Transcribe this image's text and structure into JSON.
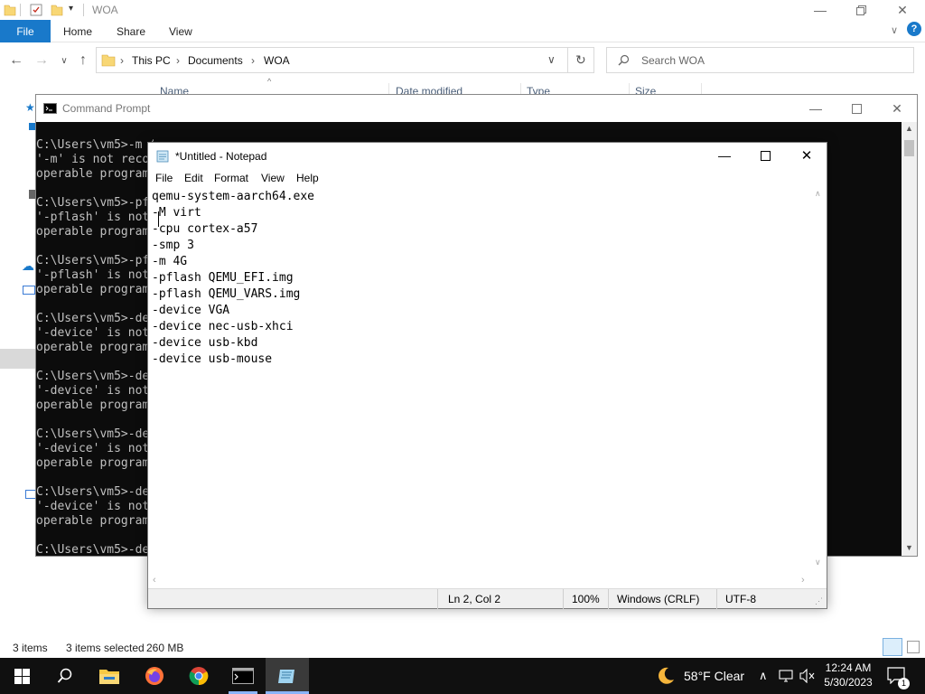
{
  "explorer": {
    "title": "WOA",
    "ribbon": {
      "file": "File",
      "home": "Home",
      "share": "Share",
      "view": "View"
    },
    "breadcrumb": [
      "This PC",
      "Documents",
      "WOA"
    ],
    "search_placeholder": "Search WOA",
    "columns": [
      "Name",
      "Date modified",
      "Type",
      "Size"
    ],
    "status": {
      "items": "3 items",
      "selected": "3 items selected",
      "size": "260 MB"
    }
  },
  "cmd": {
    "title": "Command Prompt",
    "lines": [
      "C:\\Users\\vm5>-m 4G",
      "'-m' is not recognized as an internal or external command,",
      "operable program or batch file.",
      "",
      "C:\\Users\\vm5>-pflash QEMU_EFI.img",
      "'-pflash' is not recognized as an internal or external command,",
      "operable program or batch file.",
      "",
      "C:\\Users\\vm5>-pflash QEMU_VARS.img",
      "'-pflash' is not recognized as an internal or external command,",
      "operable program or batch file.",
      "",
      "C:\\Users\\vm5>-device VGA",
      "'-device' is not recognized as an internal or external command,",
      "operable program or batch file.",
      "",
      "C:\\Users\\vm5>-device nec-usb-xhci",
      "'-device' is not recognized as an internal or external command,",
      "operable program or batch file.",
      "",
      "C:\\Users\\vm5>-device usb-kbd",
      "'-device' is not recognized as an internal or external command,",
      "operable program or batch file.",
      "",
      "C:\\Users\\vm5>-device usb-mouse",
      "'-device' is not recognized as an internal or external command,",
      "operable program or batch file.",
      "",
      "C:\\Users\\vm5>-device"
    ]
  },
  "notepad": {
    "title": "*Untitled - Notepad",
    "menu": [
      "File",
      "Edit",
      "Format",
      "View",
      "Help"
    ],
    "text": "qemu-system-aarch64.exe\n-M virt\n-cpu cortex-a57\n-smp 3\n-m 4G\n-pflash QEMU_EFI.img\n-pflash QEMU_VARS.img\n-device VGA\n-device nec-usb-xhci\n-device usb-kbd\n-device usb-mouse",
    "status": {
      "position": "Ln 2, Col 2",
      "zoom": "100%",
      "line_endings": "Windows (CRLF)",
      "encoding": "UTF-8"
    }
  },
  "taskbar": {
    "weather": "58°F  Clear",
    "time": "12:24 AM",
    "date": "5/30/2023",
    "notifications": "1"
  },
  "colors": {
    "accent": "#1979ca",
    "taskbar": "#101010",
    "console_bg": "#0c0c0c"
  }
}
